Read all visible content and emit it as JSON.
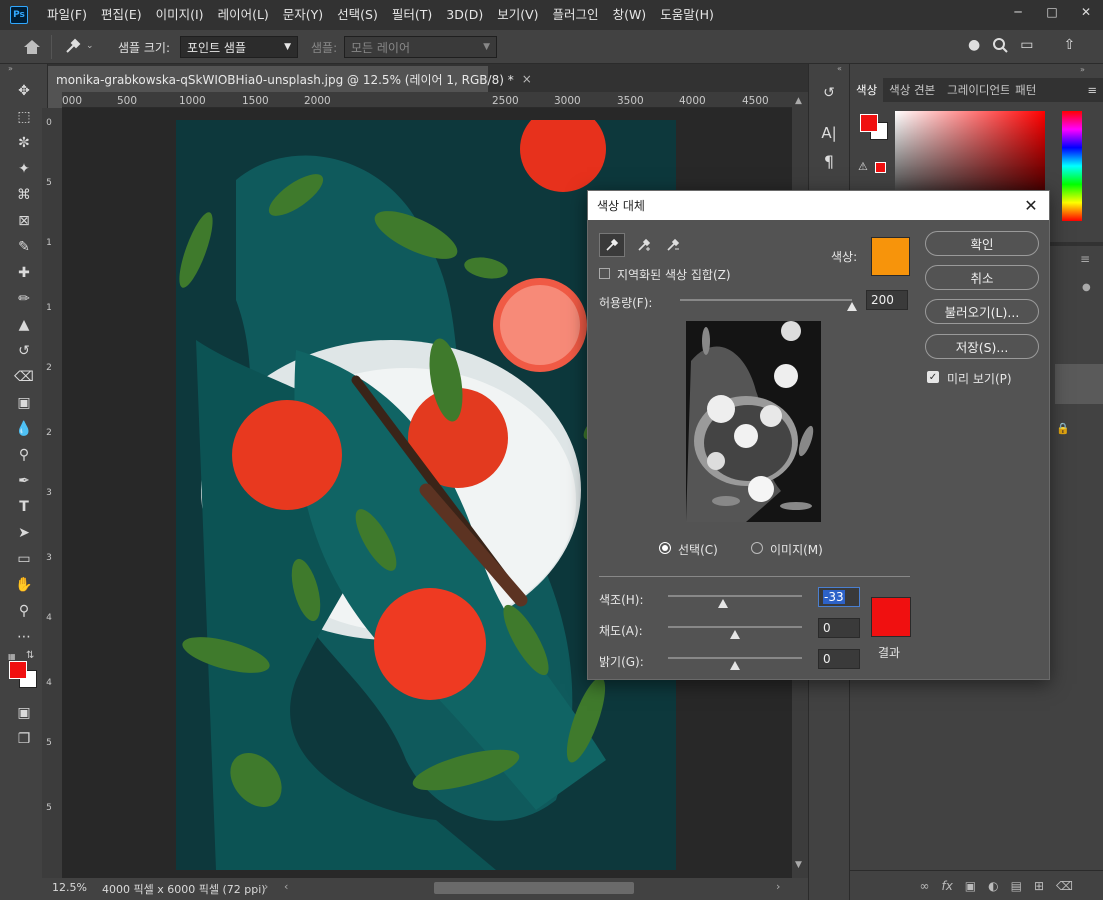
{
  "app": {
    "logo": "Ps"
  },
  "menu": [
    "파일(F)",
    "편집(E)",
    "이미지(I)",
    "레이어(L)",
    "문자(Y)",
    "선택(S)",
    "필터(T)",
    "3D(D)",
    "보기(V)",
    "플러그인",
    "창(W)",
    "도움말(H)"
  ],
  "options_bar": {
    "sample_size_label": "샘플 크기:",
    "sample_size_value": "포인트 샘플",
    "sample_label": "샘플:",
    "sample_value": "모든 레이어"
  },
  "document": {
    "tab_title": "monika-grabkowska-qSkWIOBHia0-unsplash.jpg @ 12.5% (레이어 1, RGB/8) *",
    "close": "×",
    "ruler_ticks": [
      "000",
      "500",
      "1000",
      "1500",
      "2000",
      "2500",
      "3000",
      "3500",
      "4000",
      "4500"
    ],
    "ruler_vertical": [
      "0",
      "5",
      "1",
      "1",
      "2",
      "2",
      "3",
      "3",
      "4",
      "4",
      "5",
      "5"
    ],
    "zoom": "12.5%",
    "dimensions": "4000 픽셀 x 6000 픽셀 (72 ppi)"
  },
  "panels": {
    "tabs": [
      "색상",
      "색상 견본",
      "그레이디언트",
      "패턴"
    ],
    "menu_icon": "≡"
  },
  "dialog": {
    "title": "색상 대체",
    "localized_label": "지역화된 색상 집합(Z)",
    "color_label": "색상:",
    "sample_color": "#f7940b",
    "fuzziness_label": "허용량(F):",
    "fuzziness_value": "200",
    "fuzziness_level": 1.0,
    "selection_radio": "선택(C)",
    "image_radio": "이미지(M)",
    "hue_label": "색조(H):",
    "hue_value": "-33",
    "hue_level": 0.41,
    "saturation_label": "채도(A):",
    "saturation_value": "0",
    "saturation_level": 0.5,
    "lightness_label": "밝기(G):",
    "lightness_value": "0",
    "lightness_level": 0.5,
    "result_label": "결과",
    "result_color": "#f01010",
    "ok": "확인",
    "cancel": "취소",
    "load": "불러오기(L)...",
    "save": "저장(S)...",
    "preview": "미리 보기(P)"
  },
  "colors": {
    "foreground": "#f01010",
    "background": "#ffffff",
    "accent": "#31a8ff"
  }
}
